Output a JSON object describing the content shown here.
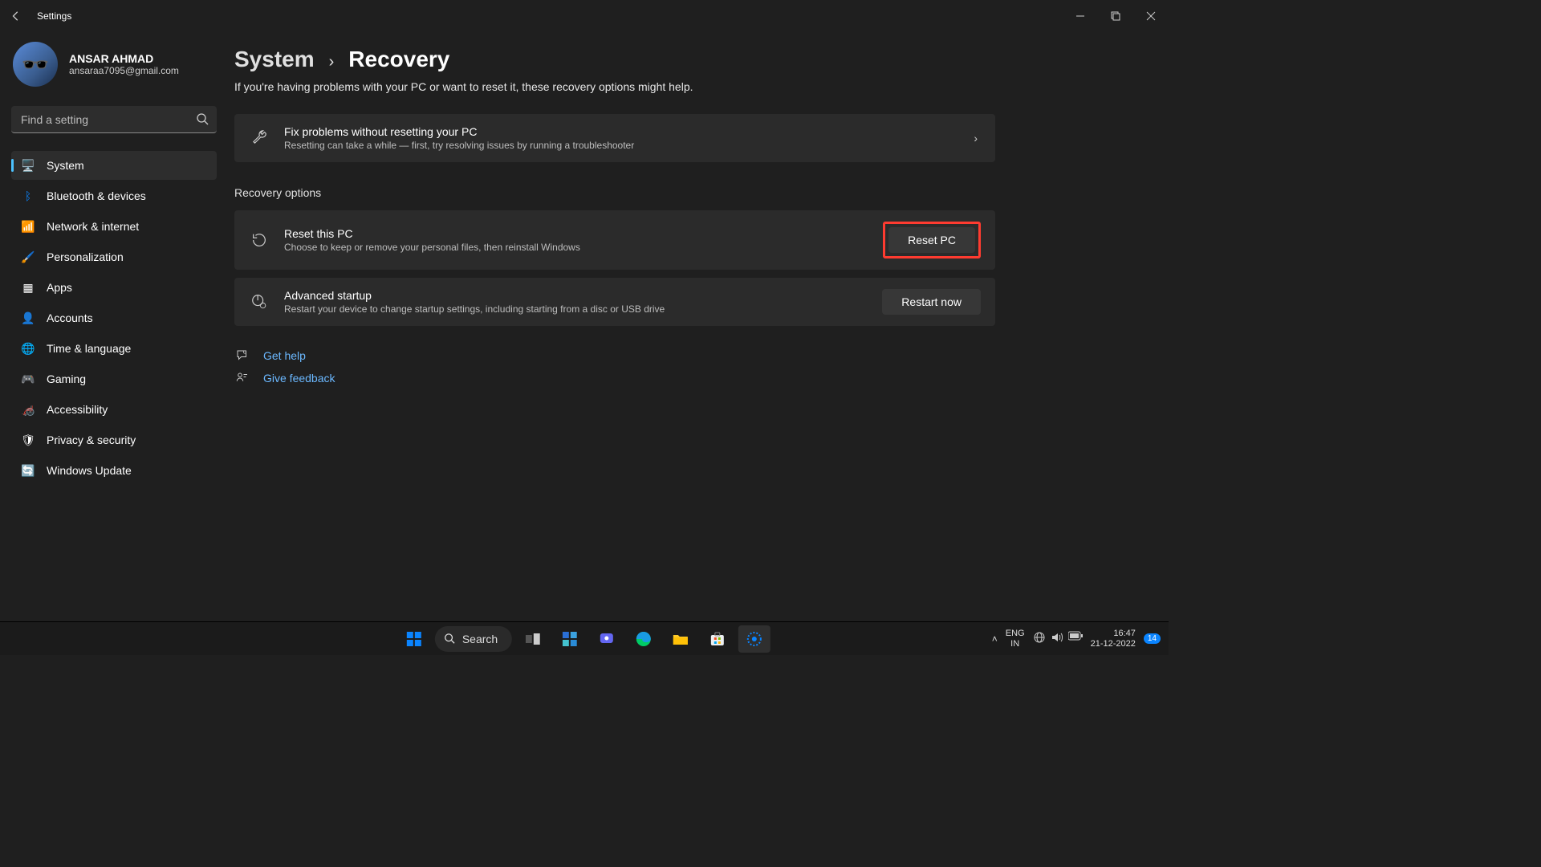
{
  "titlebar": {
    "app_title": "Settings"
  },
  "user": {
    "name": "ANSAR AHMAD",
    "email": "ansaraa7095@gmail.com"
  },
  "search": {
    "placeholder": "Find a setting"
  },
  "nav": [
    {
      "id": "system",
      "label": "System",
      "icon": "🖥️",
      "active": true
    },
    {
      "id": "bluetooth",
      "label": "Bluetooth & devices",
      "icon": "ᛒ",
      "color": "#0a84ff"
    },
    {
      "id": "network",
      "label": "Network & internet",
      "icon": "📶",
      "color": "#1a9bff"
    },
    {
      "id": "personalization",
      "label": "Personalization",
      "icon": "🖌️"
    },
    {
      "id": "apps",
      "label": "Apps",
      "icon": "▦"
    },
    {
      "id": "accounts",
      "label": "Accounts",
      "icon": "👤",
      "color": "#35c28e"
    },
    {
      "id": "time",
      "label": "Time & language",
      "icon": "🌐"
    },
    {
      "id": "gaming",
      "label": "Gaming",
      "icon": "🎮"
    },
    {
      "id": "accessibility",
      "label": "Accessibility",
      "icon": "🦽",
      "color": "#0a84ff"
    },
    {
      "id": "privacy",
      "label": "Privacy & security",
      "icon": "🛡"
    },
    {
      "id": "update",
      "label": "Windows Update",
      "icon": "🔄",
      "color": "#0a84ff"
    }
  ],
  "breadcrumb": {
    "parent": "System",
    "current": "Recovery"
  },
  "header_sub": "If you're having problems with your PC or want to reset it, these recovery options might help.",
  "card_fix": {
    "title": "Fix problems without resetting your PC",
    "desc": "Resetting can take a while — first, try resolving issues by running a troubleshooter"
  },
  "section_title": "Recovery options",
  "card_reset": {
    "title": "Reset this PC",
    "desc": "Choose to keep or remove your personal files, then reinstall Windows",
    "button": "Reset PC"
  },
  "card_adv": {
    "title": "Advanced startup",
    "desc": "Restart your device to change startup settings, including starting from a disc or USB drive",
    "button": "Restart now"
  },
  "footer_links": {
    "help": "Get help",
    "feedback": "Give feedback"
  },
  "taskbar": {
    "search_label": "Search",
    "lang_top": "ENG",
    "lang_bottom": "IN",
    "time": "16:47",
    "date": "21-12-2022",
    "notif_count": "14"
  }
}
